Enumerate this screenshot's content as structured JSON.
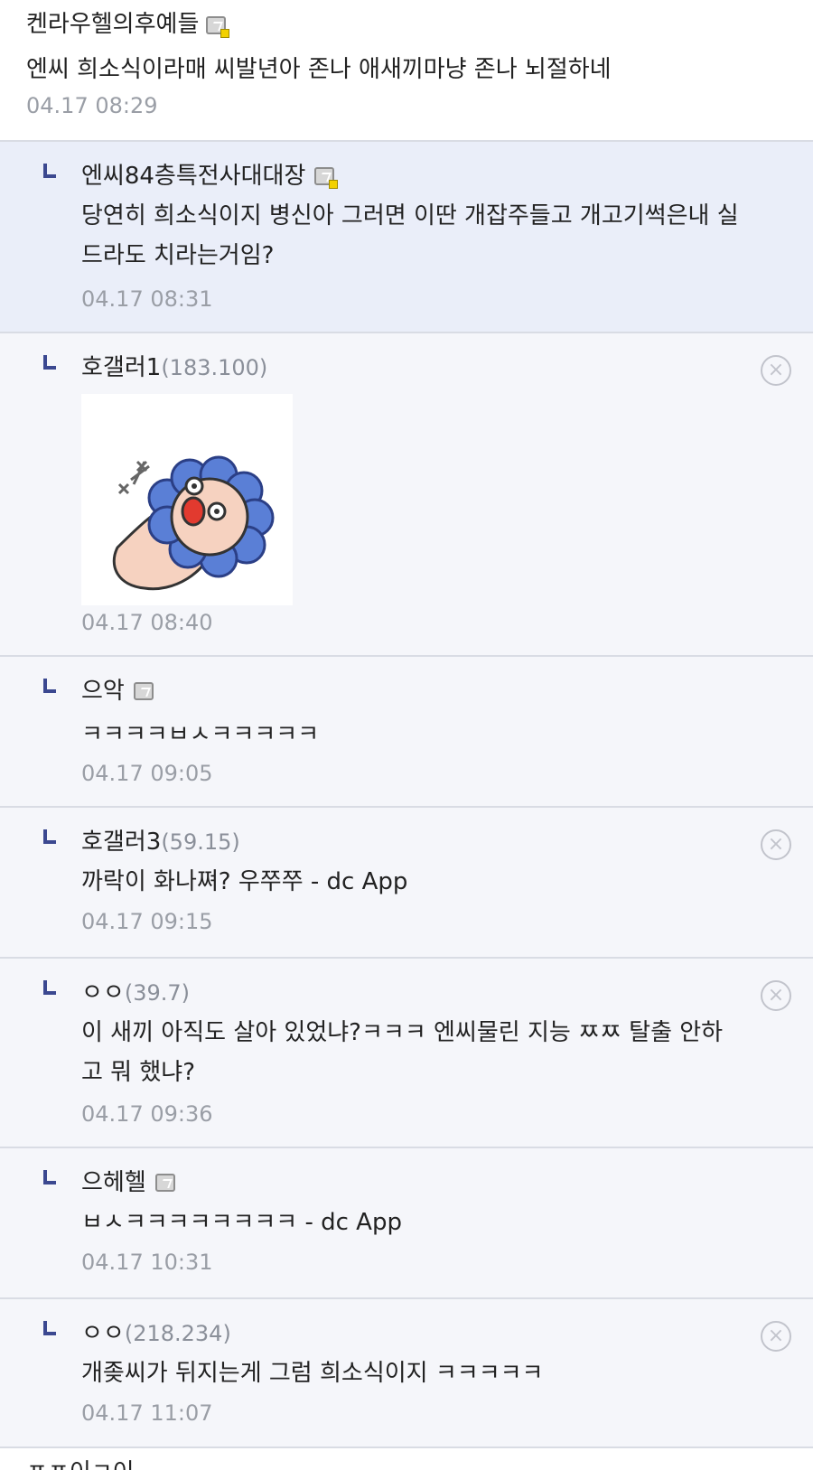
{
  "parent_comment": {
    "nickname": "켄라우헬의후예들",
    "text": "엔씨 희소식이라매 씨발년아 존나 애새끼마냥 존나 뇌절하네",
    "time": "04.17 08:29"
  },
  "replies": [
    {
      "nickname": "엔씨84층특전사대대장",
      "ip": "",
      "text_line1": "당연히 희소식이지 병신아 그러면 이딴 개잡주들고 개고기썩은내 실",
      "text_line2": "드라도 치라는거임?",
      "time": "04.17 08:31"
    },
    {
      "nickname": "호갤러1",
      "ip": "(183.100)",
      "text": "",
      "time": "04.17 08:40"
    },
    {
      "nickname": "으악",
      "ip": "",
      "text": "ㅋㅋㅋㅋㅂㅅㅋㅋㅋㅋㅋ",
      "time": "04.17 09:05"
    },
    {
      "nickname": "호갤러3",
      "ip": "(59.15)",
      "text": "까락이 화나쪄? 우쭈쭈 - dc App",
      "time": "04.17 09:15"
    },
    {
      "nickname": "ㅇㅇ",
      "ip": "(39.7)",
      "text_line1": "이 새끼 아직도 살아 있었냐?ㅋㅋㅋ 엔씨물린 지능 ㅉㅉ 탈출 안하",
      "text_line2": "고 뭐 했냐?",
      "time": "04.17 09:36"
    },
    {
      "nickname": "으헤헬",
      "ip": "",
      "text": "ㅂㅅㅋㅋㅋㅋㅋㅋㅋㅋ - dc App",
      "time": "04.17 10:31"
    },
    {
      "nickname": "ㅇㅇ",
      "ip": "(218.234)",
      "text": "개좆씨가 뒤지는게 그럼 희소식이지 ㅋㅋㅋㅋㅋ",
      "time": "04.17 11:07"
    }
  ],
  "delete_glyph": "×",
  "next_comment_partial": "ㅍㅍ이ㅋ이"
}
